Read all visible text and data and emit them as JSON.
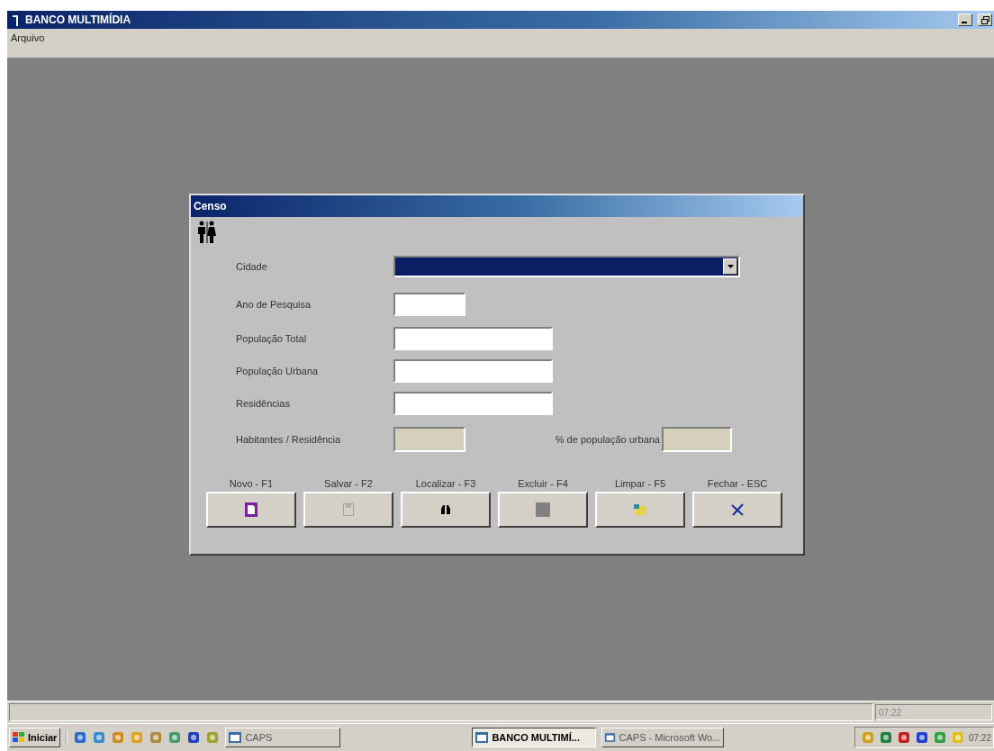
{
  "window": {
    "title": "BANCO MULTIMÍDIA"
  },
  "menu": [
    "Arquivo"
  ],
  "dialog": {
    "title": "Censo",
    "fields": [
      {
        "kind": "combo",
        "label": "Cidade"
      },
      {
        "kind": "short",
        "label": "Ano de Pesquisa"
      },
      {
        "kind": "long",
        "label": "População Total"
      },
      {
        "kind": "long",
        "label": "População Urbana"
      },
      {
        "kind": "long",
        "label": "Residências"
      }
    ],
    "computed": [
      {
        "label": "Habitantes / Residência"
      },
      {
        "label": "% de população urbana"
      }
    ],
    "buttons": [
      {
        "label": "Novo - F1",
        "kind": "new",
        "disabled": false
      },
      {
        "label": "Salvar - F2",
        "kind": "save",
        "disabled": true
      },
      {
        "label": "Localizar - F3",
        "kind": "find",
        "disabled": false
      },
      {
        "label": "Excluir - F4",
        "kind": "delete",
        "disabled": true
      },
      {
        "label": "Limpar - F5",
        "kind": "clear",
        "disabled": false
      },
      {
        "label": "Fechar - ESC",
        "kind": "close",
        "disabled": false
      }
    ]
  },
  "status_bar": {
    "time": "07:22"
  },
  "taskbar": {
    "start": "Iniciar",
    "tasks": [
      {
        "label": "CAPS",
        "selected": false
      },
      {
        "label": "BANCO MULTIMÍ...",
        "selected": true
      },
      {
        "label": "CAPS - Microsoft Wo...",
        "selected": false
      }
    ],
    "clock": "07:22"
  }
}
